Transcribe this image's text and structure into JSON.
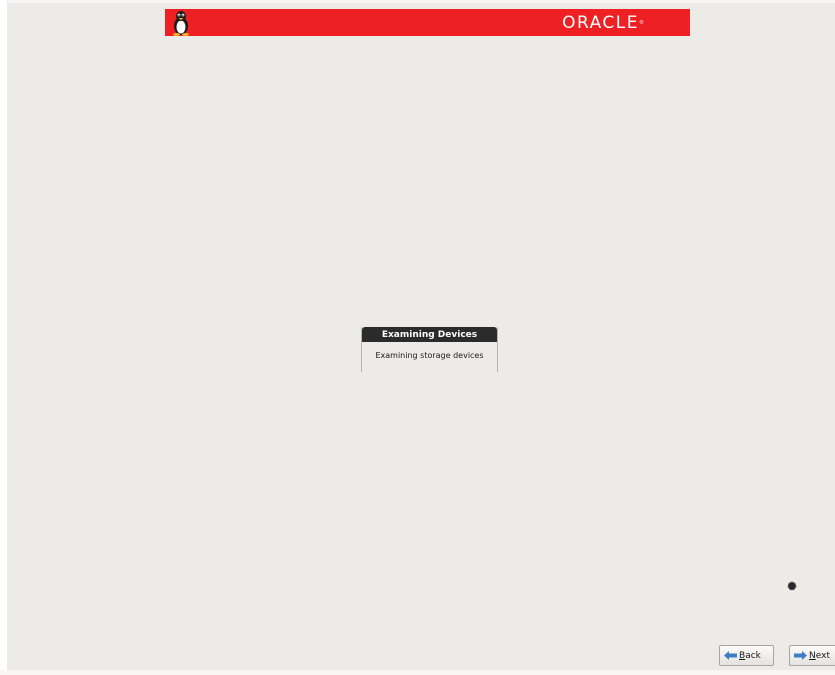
{
  "header": {
    "brand": "ORACLE",
    "brand_mark": "®",
    "logo_icon": "tux-penguin-icon",
    "color": "#ee2024"
  },
  "dialog": {
    "title": "Examining Devices",
    "message": "Examining storage devices"
  },
  "status": {
    "busy_icon": "spinner-icon"
  },
  "navigation": {
    "back": {
      "accel": "B",
      "rest": "ack",
      "icon": "arrow-left-icon"
    },
    "next": {
      "accel": "N",
      "rest": "ext",
      "icon": "arrow-right-icon"
    }
  },
  "colors": {
    "background": "#edebe8",
    "dialog_title_bg": "#2b2b2b",
    "arrow_icon": "#3f7cc4"
  }
}
